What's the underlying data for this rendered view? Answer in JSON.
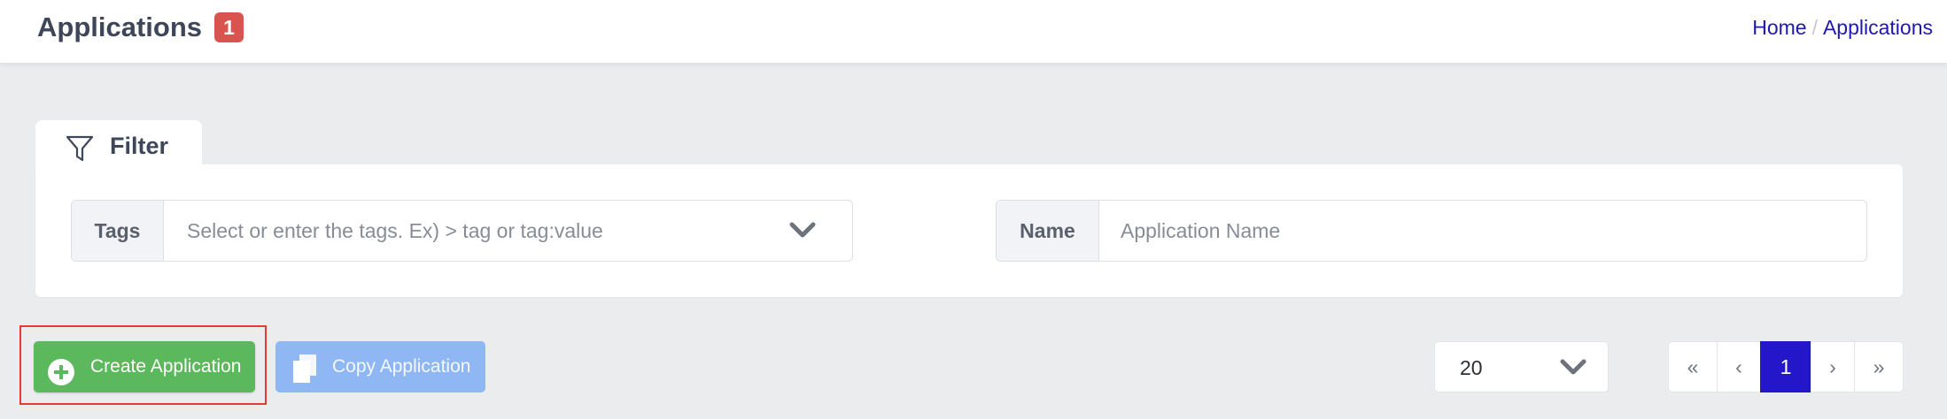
{
  "header": {
    "title": "Applications",
    "badge": "1",
    "breadcrumb": {
      "home": "Home",
      "separator": "/",
      "current": "Applications"
    }
  },
  "filter": {
    "tab_label": "Filter",
    "tab_icon": "filter-icon",
    "tags": {
      "label": "Tags",
      "placeholder": "Select or enter the tags. Ex) > tag or tag:value",
      "icon": "chevron-down-icon"
    },
    "name": {
      "label": "Name",
      "placeholder": "Application Name"
    }
  },
  "actions": {
    "create": {
      "label": "Create Application",
      "icon": "plus-circle-icon"
    },
    "copy": {
      "label": "Copy Application",
      "icon": "copy-icon"
    }
  },
  "pagination": {
    "page_size": "20",
    "first": "«",
    "prev": "‹",
    "current": "1",
    "next": "›",
    "last": "»"
  },
  "colors": {
    "accent": "#2416c9",
    "success": "#5cb85c",
    "copy_button": "#8fb7f4",
    "badge": "#d9534f",
    "highlight": "#e53935"
  }
}
